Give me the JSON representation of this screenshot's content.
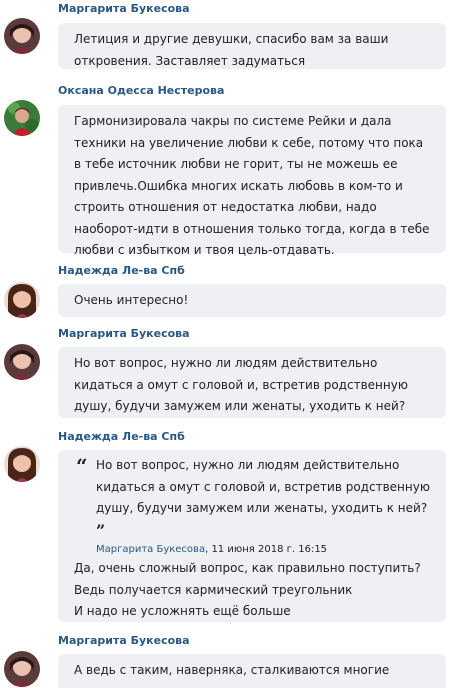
{
  "messages": [
    {
      "author": "Маргарита Букесова",
      "avatar": "avatar-margarita",
      "lines": [
        "Летиция и другие девушки, спасибо вам за ваши откровения. Заставляет задуматься"
      ]
    },
    {
      "author": "Оксана Одесса Нестерова",
      "avatar": "avatar-oksana",
      "lines": [
        "Гармонизировала чакры по системе Рейки и дала техники на увеличение любви к себе, потому что пока в тебе источник любви не горит, ты не можешь ее привлечь.Ошибка многих искать любовь в ком-то и строить отношения от недостатка любви, надо наоборот-идти в отношения только тогда, когда в тебе любви с избытком и твоя цель-отдавать."
      ]
    },
    {
      "author": "Надежда Ле-ва Спб",
      "avatar": "avatar-nadezhda",
      "lines": [
        "Очень интересно!"
      ]
    },
    {
      "author": "Маргарита Букесова",
      "avatar": "avatar-margarita",
      "lines": [
        "Но вот вопрос, нужно ли людям действительно кидаться а омут с головой и, встретив родственную душу, будучи замужем или женаты, уходить к ней?"
      ]
    },
    {
      "author": "Надежда Ле-ва Спб",
      "avatar": "avatar-nadezhda",
      "quote": {
        "text": "Но вот вопрос, нужно ли людям действительно кидаться а омут с головой и, встретив родственную душу, будучи замужем или женаты, уходить к ней?",
        "author": "Маргарита Букесова",
        "date": "11 июня 2018 г. 16:15"
      },
      "lines": [
        "Да, очень сложный вопрос, как правильно поступить?",
        "Ведь получается кармический треугольник",
        "И надо не усложнять ещё больше"
      ]
    },
    {
      "author": "Маргарита Букесова",
      "avatar": "avatar-margarita",
      "lines": [
        "А ведь с таким, наверняка, сталкиваются многие"
      ]
    }
  ],
  "colors": {
    "author_link": "#2a5885",
    "bubble_bg": "#eef0f4",
    "text": "#222222"
  }
}
